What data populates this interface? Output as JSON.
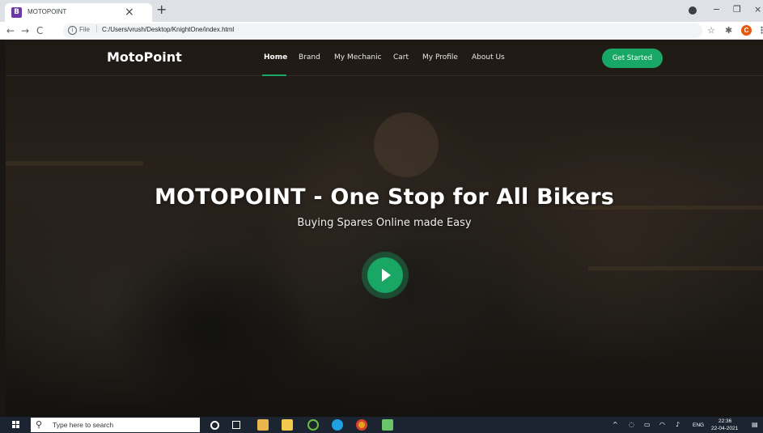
{
  "browser": {
    "tab_title": "MOTOPOINT",
    "tab_favicon_letter": "B",
    "tab_close": "×",
    "new_tab": "+",
    "minimize": "−",
    "restore": "❐",
    "close": "×",
    "back": "←",
    "forward": "→",
    "reload": "C",
    "url_scheme": "File",
    "url_path": "C:/Users/vrush/Desktop/KnightOne/index.html",
    "bookmark_icon": "star-icon",
    "extensions_icon": "puzzle-icon",
    "avatar_letter": "C",
    "menu_icon": "⋮"
  },
  "site": {
    "logo": "MotoPoint",
    "nav": [
      {
        "label": "Home",
        "active": true
      },
      {
        "label": "Brand",
        "active": false
      },
      {
        "label": "My Mechanic",
        "active": false
      },
      {
        "label": "Cart",
        "active": false
      },
      {
        "label": "My Profile",
        "active": false
      },
      {
        "label": "About Us",
        "active": false
      }
    ],
    "cta_label": "Get Started",
    "hero_title": "MOTOPOINT - One Stop for All Bikers",
    "hero_subtitle": "Buying Spares Online made Easy",
    "accent_color": "#18a764"
  },
  "taskbar": {
    "search_placeholder": "Type here to search",
    "language": "ENG",
    "time": "22:36",
    "date": "22-04-2021"
  }
}
